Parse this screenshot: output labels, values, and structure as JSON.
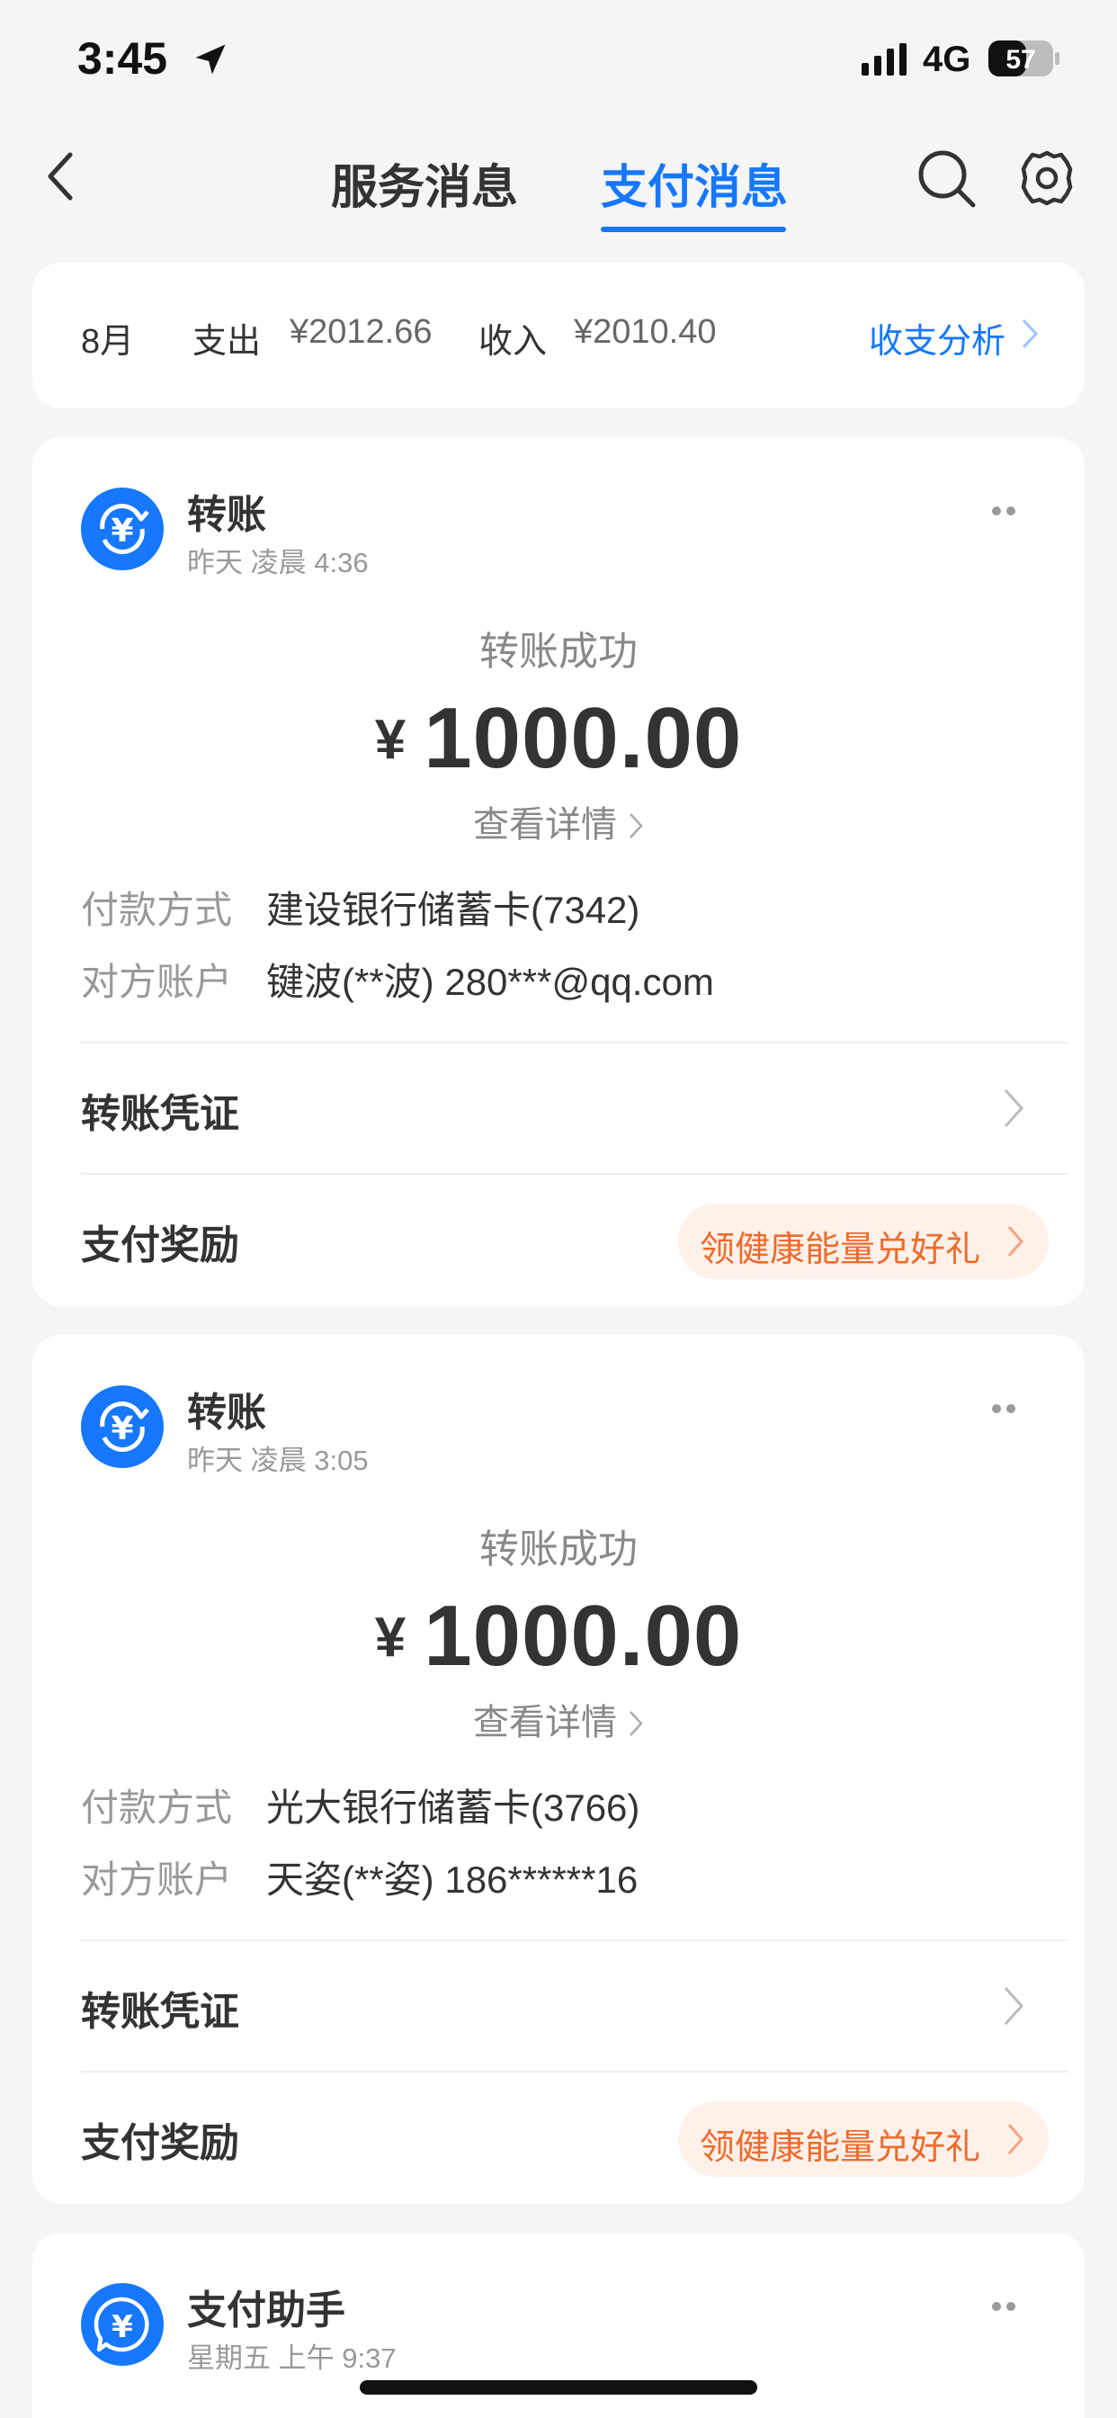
{
  "status_bar": {
    "time": "3:45",
    "network": "4G",
    "battery": "57"
  },
  "nav": {
    "tabs": [
      {
        "label": "服务消息",
        "active": false
      },
      {
        "label": "支付消息",
        "active": true
      }
    ],
    "icons": [
      "back-icon",
      "search-icon",
      "gear-icon"
    ]
  },
  "summary": {
    "month": "8月",
    "expense_label": "支出",
    "expense_value": "¥2012.66",
    "income_label": "收入",
    "income_value": "¥2010.40",
    "analysis_link": "收支分析"
  },
  "cards": [
    {
      "title": "转账",
      "time": "昨天 凌晨 4:36",
      "status": "转账成功",
      "currency": "¥",
      "amount": "1000.00",
      "detail_link": "查看详情",
      "pay_method_label": "付款方式",
      "pay_method_value": "建设银行储蓄卡(7342)",
      "account_label": "对方账户",
      "account_value": "键波(**波) 280***@qq.com",
      "voucher_label": "转账凭证",
      "reward_label": "支付奖励",
      "reward_pill": "领健康能量兑好礼"
    },
    {
      "title": "转账",
      "time": "昨天 凌晨 3:05",
      "status": "转账成功",
      "currency": "¥",
      "amount": "1000.00",
      "detail_link": "查看详情",
      "pay_method_label": "付款方式",
      "pay_method_value": "光大银行储蓄卡(3766)",
      "account_label": "对方账户",
      "account_value": "天姿(**姿) 186******16",
      "voucher_label": "转账凭证",
      "reward_label": "支付奖励",
      "reward_pill": "领健康能量兑好礼"
    },
    {
      "title": "支付助手",
      "time": "星期五 上午 9:37"
    }
  ],
  "colors": {
    "accent": "#1677ff",
    "reward_text": "#f06a2b",
    "reward_bg": "#fff1ea",
    "background": "#f5f5f5"
  }
}
